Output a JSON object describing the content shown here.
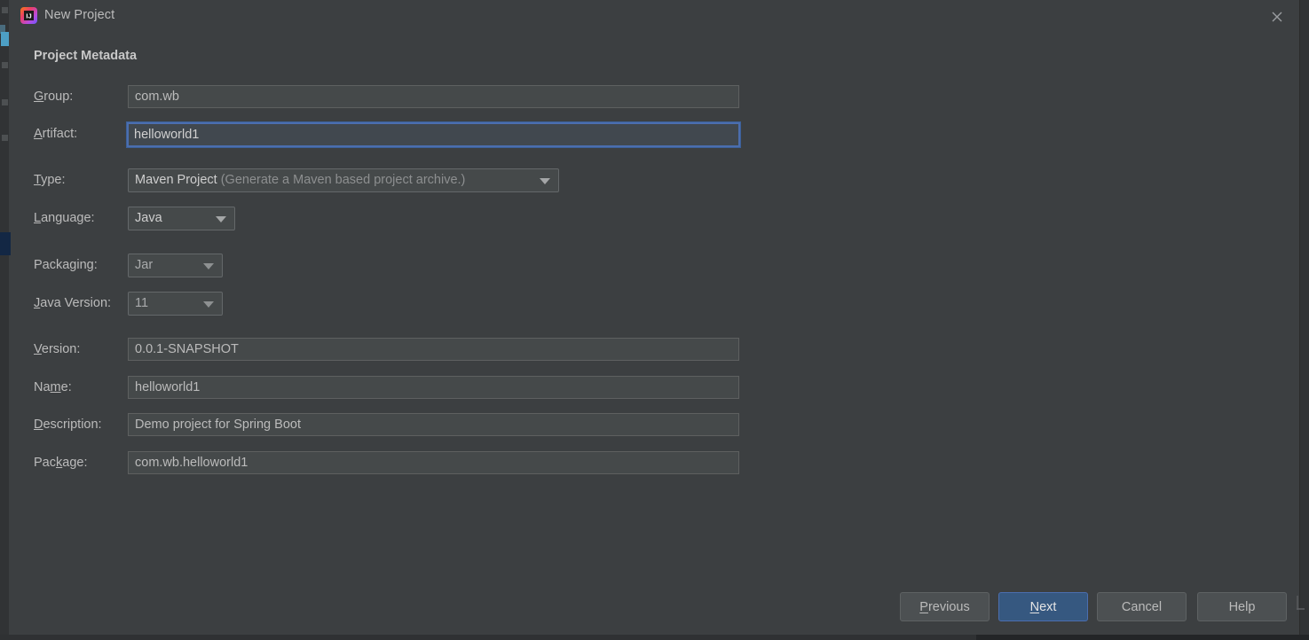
{
  "window": {
    "title": "New Project",
    "icon": "intellij-idea-logo",
    "close_icon": "close-icon"
  },
  "section": {
    "heading": "Project Metadata"
  },
  "fields": {
    "group": {
      "label_pre": "",
      "label_mnemonic": "G",
      "label_post": "roup:",
      "value": "com.wb",
      "type": "text"
    },
    "artifact": {
      "label_pre": "",
      "label_mnemonic": "A",
      "label_post": "rtifact:",
      "value": "helloworld1",
      "type": "text",
      "focused": true
    },
    "type": {
      "label_pre": "",
      "label_mnemonic": "T",
      "label_post": "ype:",
      "value_strong": "Maven Project",
      "value_dim": "(Generate a Maven based project archive.)",
      "type": "combo"
    },
    "language": {
      "label_pre": "",
      "label_mnemonic": "L",
      "label_post": "anguage:",
      "value": "Java",
      "type": "combo"
    },
    "packaging": {
      "label_pre": "Packaging:",
      "label_mnemonic": "",
      "label_post": "",
      "value": "Jar",
      "type": "combo"
    },
    "java_version": {
      "label_pre": "",
      "label_mnemonic": "J",
      "label_post": "ava Version:",
      "value": "11",
      "type": "combo"
    },
    "version": {
      "label_pre": "",
      "label_mnemonic": "V",
      "label_post": "ersion:",
      "value": "0.0.1-SNAPSHOT",
      "type": "text"
    },
    "name": {
      "label_pre": "Na",
      "label_mnemonic": "m",
      "label_post": "e:",
      "value": "helloworld1",
      "type": "text"
    },
    "description": {
      "label_pre": "",
      "label_mnemonic": "D",
      "label_post": "escription:",
      "value": "Demo project for Spring Boot",
      "type": "text"
    },
    "package": {
      "label_pre": "Pac",
      "label_mnemonic": "k",
      "label_post": "age:",
      "value": "com.wb.helloworld1",
      "type": "text"
    }
  },
  "buttons": {
    "previous": {
      "pre": "",
      "mnemonic": "P",
      "post": "revious"
    },
    "next": {
      "pre": "",
      "mnemonic": "N",
      "post": "ext",
      "primary": true
    },
    "cancel": {
      "pre": "Cancel",
      "mnemonic": "",
      "post": ""
    },
    "help": {
      "pre": "Help",
      "mnemonic": "",
      "post": ""
    }
  },
  "colors": {
    "dialog_bg": "#3c3f41",
    "field_bg": "#45494a",
    "field_border": "#5e6060",
    "focus_border": "#4b6eaf",
    "primary_button_bg": "#365880",
    "text": "#bbbbbb",
    "dim_text": "#8d8f90"
  }
}
